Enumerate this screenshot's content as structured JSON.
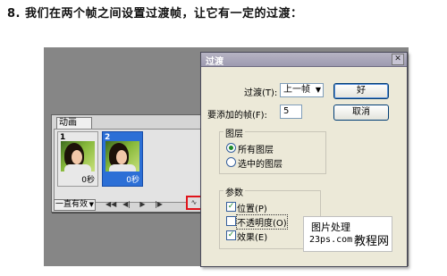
{
  "headline": "8. 我们在两个帧之间设置过渡帧，让它有一定的过渡：",
  "animation_panel": {
    "tab_label": "动画",
    "frames": [
      {
        "number": "1",
        "time": "0秒",
        "selected": false
      },
      {
        "number": "2",
        "time": "0秒",
        "selected": true
      }
    ],
    "loop_option": "一直有效",
    "controls": [
      "◀◀",
      "◀|",
      "▶",
      "|▶"
    ],
    "tween_icon": "tween-icon"
  },
  "dialog": {
    "title": "过渡",
    "tween_with_label": "过渡(T):",
    "tween_with_value": "上一帧",
    "frames_to_add_label": "要添加的帧(F):",
    "frames_to_add_value": "5",
    "ok_label": "好",
    "cancel_label": "取消",
    "layers_group": {
      "title": "图层",
      "options": [
        {
          "label": "所有图层",
          "selected": true
        },
        {
          "label": "选中的图层",
          "selected": false
        }
      ]
    },
    "params_group": {
      "title": "参数",
      "options": [
        {
          "label": "位置(P)",
          "checked": true
        },
        {
          "label": "不透明度(O)",
          "checked": false
        },
        {
          "label": "效果(E)",
          "checked": true
        }
      ]
    }
  },
  "watermark": {
    "line1": "图片处理",
    "line2": "23ps.com",
    "line3": "教程网"
  }
}
